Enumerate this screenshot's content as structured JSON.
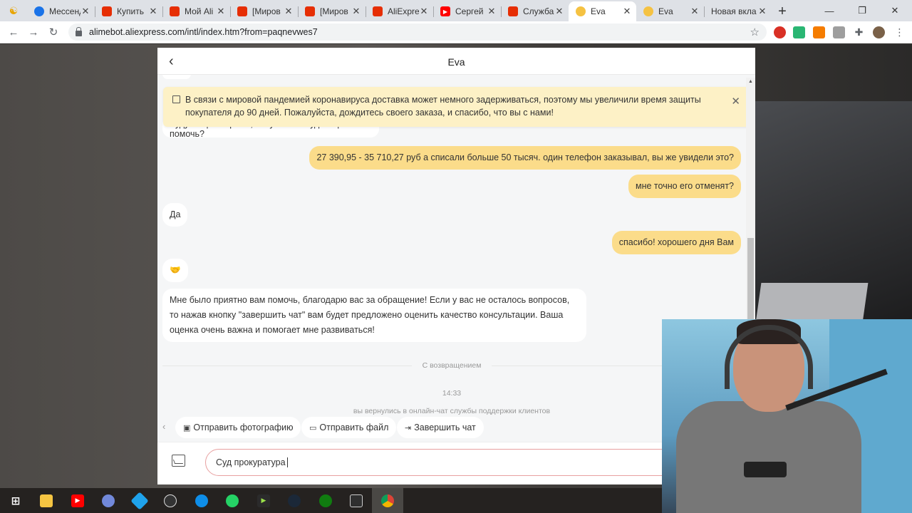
{
  "browser": {
    "tabs": [
      {
        "label": "Мессенд",
        "icon": "messenger-icon",
        "color": "#1a73e8"
      },
      {
        "label": "Купить",
        "icon": "aliexpress-icon",
        "color": "#e62e04"
      },
      {
        "label": "Мой Ali",
        "icon": "aliexpress-icon",
        "color": "#e62e04"
      },
      {
        "label": "[Миров",
        "icon": "aliexpress-icon",
        "color": "#e62e04"
      },
      {
        "label": "[Миров",
        "icon": "aliexpress-icon",
        "color": "#e62e04"
      },
      {
        "label": "AliExpre",
        "icon": "aliexpress-icon",
        "color": "#e62e04"
      },
      {
        "label": "Сергей",
        "icon": "youtube-icon",
        "color": "#ff0000"
      },
      {
        "label": "Служба",
        "icon": "aliexpress-cart-icon",
        "color": "#e62e04"
      },
      {
        "label": "Eva",
        "icon": "eva-bot-icon",
        "color": "#f5c242",
        "active": true
      },
      {
        "label": "Eva",
        "icon": "eva-bot-icon",
        "color": "#f5c242"
      },
      {
        "label": "Новая вкла",
        "icon": "",
        "color": ""
      }
    ],
    "url": "alimebot.aliexpress.com/intl/index.htm?from=paqnevwes7"
  },
  "chat": {
    "title": "Eva",
    "notice": "В связи с мировой пандемией коронавируса доставка может немного задерживаться, поэтому мы увеличили время защиты покупателя до 90 дней. Пожалуйста, дождитесь своего заказа, и спасибо, что вы с нами!",
    "partial_message": "Будут еще вопросы, могу чем-нибудь еще помочь?",
    "messages": [
      {
        "from": "user",
        "text": "27 390,95 - 35 710,27 руб а списали больше 50 тысяч. один телефон заказывал, вы же увидели это?"
      },
      {
        "from": "user",
        "text": "мне точно его отменят?"
      },
      {
        "from": "bot",
        "text": "Да"
      },
      {
        "from": "user",
        "text": "спасибо! хорошего дня Вам"
      },
      {
        "from": "bot",
        "text": "🤝"
      },
      {
        "from": "bot",
        "text": "Мне было приятно вам помочь, благодарю вас за обращение! Если у вас не осталось вопросов, то нажав кнопку \"завершить чат\" вам будет предложено оценить качество консультации. Ваша оценка очень важна и помогает мне развиваться!"
      }
    ],
    "divider_label": "С возвращением",
    "timestamp": "14:33",
    "system_message": "вы вернулись в онлайн-чат службы поддержки клиентов",
    "quick_actions": {
      "send_photo": "Отправить фотографию",
      "send_file": "Отправить файл",
      "end_chat": "Завершить чат"
    },
    "input_value": "Суд прокуратура"
  },
  "taskbar": {
    "apps": [
      "windows-start",
      "file-explorer",
      "youtube",
      "discord",
      "sketch",
      "obs",
      "teamviewer",
      "whatsapp",
      "garmin",
      "steam",
      "xbox",
      "epic-games",
      "chrome"
    ],
    "active_app": "chrome"
  }
}
